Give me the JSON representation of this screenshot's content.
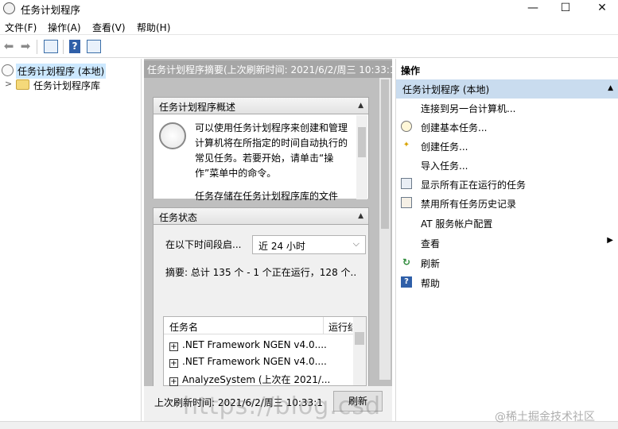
{
  "window": {
    "title": "任务计划程序",
    "buttons": {
      "minimize": "—",
      "maximize": "☐",
      "close": "✕"
    }
  },
  "menu": [
    "文件(F)",
    "操作(A)",
    "查看(V)",
    "帮助(H)"
  ],
  "tree": {
    "root": "任务计划程序 (本地)",
    "child": "任务计划程序库"
  },
  "middle": {
    "header": "任务计划程序摘要(上次刷新时间: 2021/6/2/周三 10:33:1",
    "overview": {
      "title": "任务计划程序概述",
      "text": "可以使用任务计划程序来创建和管理计算机将在所指定的时间自动执行的常见任务。若要开始，请单击“操作”菜单中的命令。",
      "text2": "任务存储在任务计划程序库的文件"
    },
    "status": {
      "title": "任务状态",
      "period_label": "在以下时间段启...",
      "period_value": "近 24 小时",
      "summary": "摘要: 总计 135 个 - 1 个正在运行，128 个..."
    },
    "grid": {
      "columns": [
        "任务名",
        "运行结"
      ],
      "rows": [
        ".NET Framework NGEN v4.0....",
        ".NET Framework NGEN v4.0....",
        "AnalyzeSystem (上次在 2021/..."
      ]
    },
    "last_refresh": "上次刷新时间: 2021/6/2/周三 10:33:1",
    "refresh_button": "刷新"
  },
  "actions": {
    "header": "操作",
    "group": "任务计划程序 (本地)",
    "items": [
      {
        "label": "连接到另一台计算机...",
        "icon": "none"
      },
      {
        "label": "创建基本任务...",
        "icon": "clock-create-icon"
      },
      {
        "label": "创建任务...",
        "icon": "task-create-icon"
      },
      {
        "label": "导入任务...",
        "icon": "none"
      },
      {
        "label": "显示所有正在运行的任务",
        "icon": "running-tasks-icon"
      },
      {
        "label": "禁用所有任务历史记录",
        "icon": "history-icon"
      },
      {
        "label": "AT 服务帐户配置",
        "icon": "none"
      },
      {
        "label": "查看",
        "icon": "none"
      },
      {
        "label": "刷新",
        "icon": "refresh-icon"
      },
      {
        "label": "帮助",
        "icon": "help-icon"
      }
    ]
  },
  "watermark": "@稀土掘金技术社区",
  "watermark_url": "https://blog.csd",
  "colors": {
    "selection": "#cce8ff",
    "group_header": "#c9dcef",
    "middle_bg": "#bfbfbf"
  }
}
